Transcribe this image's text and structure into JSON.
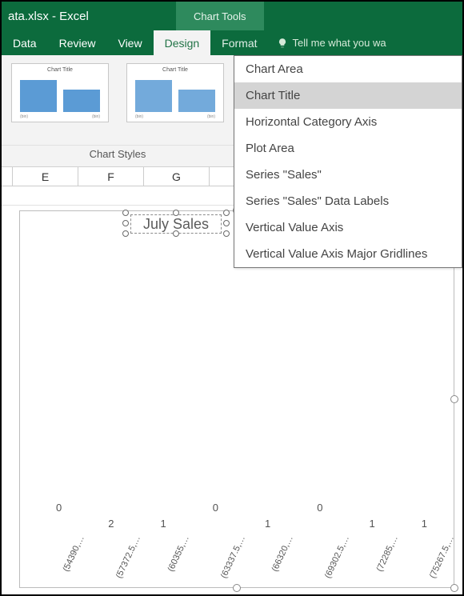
{
  "titlebar": {
    "filename": "ata.xlsx - Excel",
    "chart_tools": "Chart Tools"
  },
  "tabs": {
    "main": [
      "Data",
      "Review",
      "View"
    ],
    "contextual": [
      "Design",
      "Format"
    ],
    "active": "Design",
    "tellme": "Tell me what you wa"
  },
  "ribbon": {
    "styles_group_label": "Chart Styles",
    "thumb_title": "Chart Title",
    "thumb_axis": [
      "(bin)",
      "(bin)"
    ]
  },
  "dropdown": {
    "items": [
      "Chart Area",
      "Chart Title",
      "Horizontal Category Axis",
      "Plot Area",
      "Series \"Sales\"",
      "Series \"Sales\" Data Labels",
      "Vertical Value Axis",
      "Vertical Value Axis Major Gridlines"
    ],
    "highlighted_index": 1
  },
  "sheet": {
    "visible_cols": [
      "",
      "E",
      "F",
      "G",
      ""
    ]
  },
  "chart_data": {
    "type": "bar",
    "title": "July Sales",
    "categories": [
      "(54390,…",
      "(57372.5,…",
      "(60355,…",
      "(63337.5,…",
      "(66320,…",
      "(69302.5,…",
      "(72285,…",
      "(75267.5,…"
    ],
    "values": [
      0,
      2,
      1,
      0,
      1,
      0,
      1,
      1
    ],
    "data_labels": [
      0,
      2,
      1,
      0,
      1,
      0,
      1,
      1
    ],
    "ylabel": "",
    "xlabel": "",
    "ylim": [
      0,
      2
    ]
  },
  "colors": {
    "brand": "#0c6b3d",
    "brand_hover": "#2e8a5d",
    "bar": "#5b9bd5"
  }
}
